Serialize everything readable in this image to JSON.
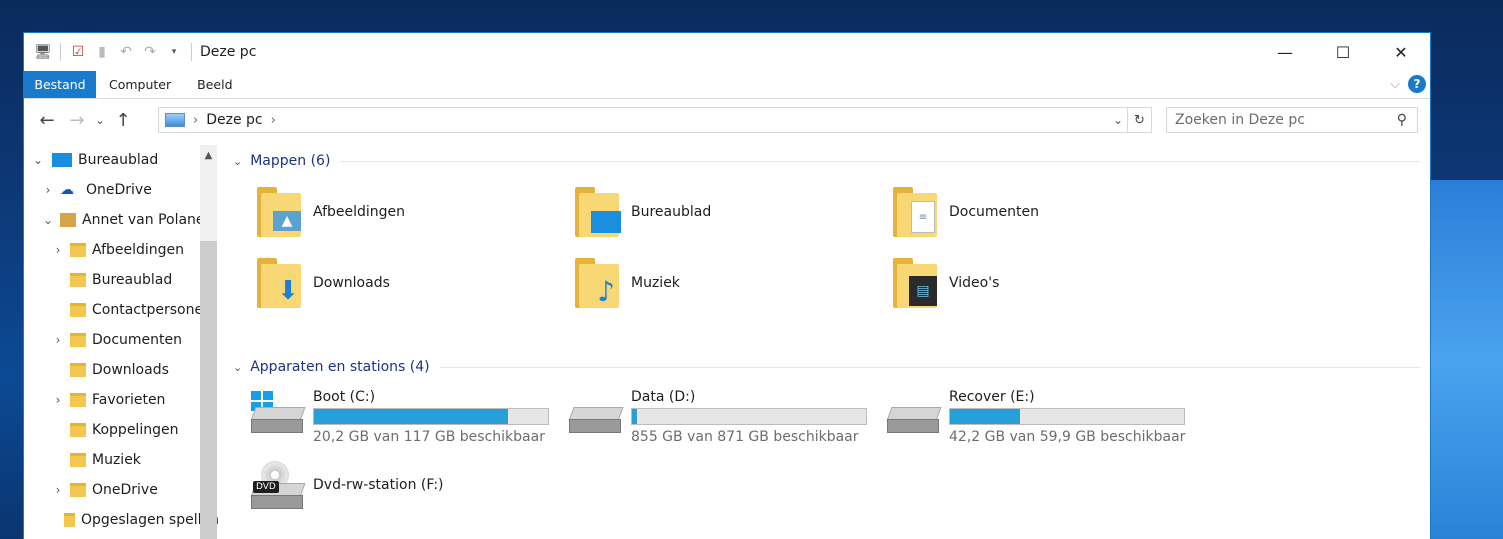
{
  "window": {
    "title": "Deze pc",
    "controls": {
      "minimize": "—",
      "maximize": "☐",
      "close": "✕"
    }
  },
  "ribbon": {
    "tabs": [
      "Bestand",
      "Computer",
      "Beeld"
    ],
    "expand_icon": "chevron-down-icon",
    "help_label": "?"
  },
  "address": {
    "crumb": "Deze pc",
    "search_placeholder": "Zoeken in Deze pc"
  },
  "nav": [
    {
      "label": "Bureaublad",
      "indent": 0,
      "arrow": "expanded"
    },
    {
      "label": "OneDrive",
      "indent": 1,
      "arrow": "collapsed"
    },
    {
      "label": "Annet van Polanen",
      "indent": 1,
      "arrow": "expanded"
    },
    {
      "label": "Afbeeldingen",
      "indent": 2,
      "arrow": "collapsed"
    },
    {
      "label": "Bureaublad",
      "indent": 2,
      "arrow": "none"
    },
    {
      "label": "Contactpersonen",
      "indent": 2,
      "arrow": "none"
    },
    {
      "label": "Documenten",
      "indent": 2,
      "arrow": "collapsed"
    },
    {
      "label": "Downloads",
      "indent": 2,
      "arrow": "none"
    },
    {
      "label": "Favorieten",
      "indent": 2,
      "arrow": "collapsed"
    },
    {
      "label": "Koppelingen",
      "indent": 2,
      "arrow": "none"
    },
    {
      "label": "Muziek",
      "indent": 2,
      "arrow": "none"
    },
    {
      "label": "OneDrive",
      "indent": 2,
      "arrow": "collapsed"
    },
    {
      "label": "Opgeslagen spellen",
      "indent": 2,
      "arrow": "none"
    }
  ],
  "groups": {
    "folders_header": "Mappen (6)",
    "devices_header": "Apparaten en stations (4)"
  },
  "folders": [
    {
      "name": "Afbeeldingen",
      "icon": "picture-icon"
    },
    {
      "name": "Bureaublad",
      "icon": "desktop-icon"
    },
    {
      "name": "Documenten",
      "icon": "document-icon"
    },
    {
      "name": "Downloads",
      "icon": "download-arrow-icon"
    },
    {
      "name": "Muziek",
      "icon": "music-note-icon"
    },
    {
      "name": "Video's",
      "icon": "film-icon"
    }
  ],
  "drives": [
    {
      "name": "Boot (C:)",
      "free": "20,2 GB van 117 GB beschikbaar",
      "used_fraction": 0.83,
      "icon": "windows-drive-icon"
    },
    {
      "name": "Data (D:)",
      "free": "855 GB van 871 GB beschikbaar",
      "used_fraction": 0.02,
      "icon": "hard-drive-icon"
    },
    {
      "name": "Recover (E:)",
      "free": "42,2 GB van 59,9 GB beschikbaar",
      "used_fraction": 0.3,
      "icon": "hard-drive-icon"
    },
    {
      "name": "Dvd-rw-station (F:)",
      "free": "",
      "used_fraction": null,
      "icon": "dvd-drive-icon"
    }
  ],
  "colors": {
    "accent": "#1979ca",
    "bar_fill": "#26a0da",
    "group_header": "#1e3287"
  }
}
